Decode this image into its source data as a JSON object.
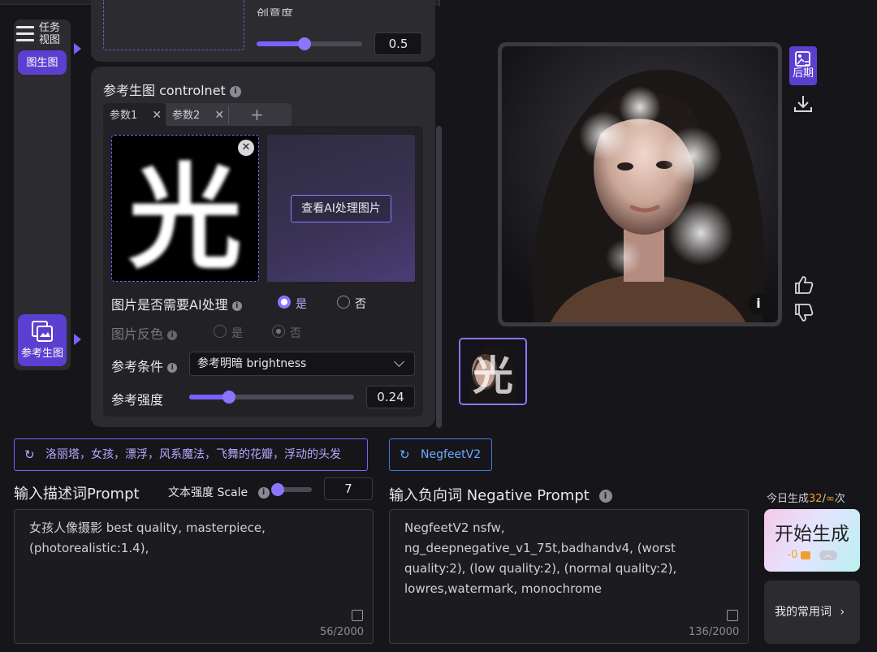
{
  "rail": {
    "task_view_label": "任务\n视图",
    "img2img_label": "图生图",
    "ref_img_label": "参考生图"
  },
  "top_panel": {
    "partial_label": "创意度",
    "value": "0.5",
    "slider_fraction": 0.45
  },
  "controlnet": {
    "title": "参考生图 controlnet",
    "tabs": [
      {
        "label": "参数1"
      },
      {
        "label": "参数2"
      }
    ],
    "add_tab": "+",
    "source_image_text": "光",
    "view_ai_button": "查看AI处理图片",
    "ai_process": {
      "label": "图片是否需要AI处理",
      "yes": "是",
      "no": "否",
      "selected": "yes"
    },
    "invert": {
      "label": "图片反色",
      "yes": "是",
      "no": "否",
      "selected": "no"
    },
    "condition": {
      "label": "参考条件",
      "value": "参考明暗 brightness"
    },
    "strength": {
      "label": "参考强度",
      "value": "0.24",
      "slider_fraction": 0.24
    }
  },
  "chips": {
    "prompt_preset": "洛丽塔，女孩，漂浮，风系魔法，飞舞的花瓣，浮动的头发",
    "negative_preset": "NegfeetV2"
  },
  "prompt": {
    "title": "输入描述词Prompt",
    "scale_label": "文本强度 Scale",
    "scale_value": "7",
    "scale_fraction": 0.0,
    "text": "女孩人像摄影 best quality, masterpiece, (photorealistic:1.4),",
    "count": "56/2000"
  },
  "negative": {
    "title": "输入负向词 Negative Prompt",
    "text": "NegfeetV2 nsfw, ng_deepnegative_v1_75t,badhandv4, (worst quality:2), (low quality:2), (normal quality:2), lowres,watermark, monochrome",
    "count": "136/2000"
  },
  "generate": {
    "today_label": "今日生成",
    "today_count": "32",
    "today_sep": "/",
    "today_total": "∞",
    "today_unit": "次",
    "button_label": "开始生成",
    "cost": "-0"
  },
  "common_words": "我的常用词",
  "side_tools": {
    "post_label": "后期"
  },
  "colors": {
    "accent": "#7b61ff",
    "accent_dark": "#5b3fd0",
    "bg": "#16161a",
    "panel": "#2b2b30",
    "orange": "#f0a030"
  }
}
